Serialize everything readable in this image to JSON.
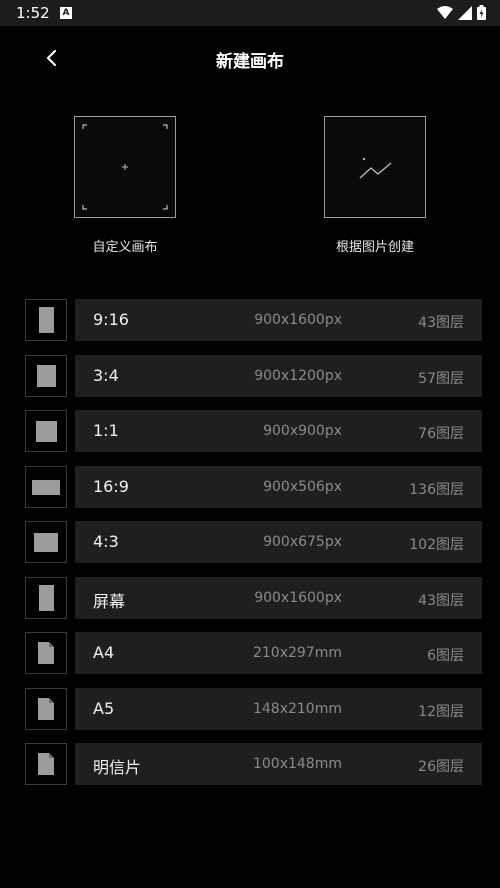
{
  "status": {
    "time": "1:52",
    "notif": "A"
  },
  "header": {
    "title": "新建画布"
  },
  "cards": [
    {
      "label": "自定义画布"
    },
    {
      "label": "根据图片创建"
    }
  ],
  "presets": [
    {
      "name": "9:16",
      "size": "900x1600px",
      "layers": "43图层"
    },
    {
      "name": "3:4",
      "size": "900x1200px",
      "layers": "57图层"
    },
    {
      "name": "1:1",
      "size": "900x900px",
      "layers": "76图层"
    },
    {
      "name": "16:9",
      "size": "900x506px",
      "layers": "136图层"
    },
    {
      "name": "4:3",
      "size": "900x675px",
      "layers": "102图层"
    },
    {
      "name": "屏幕",
      "size": "900x1600px",
      "layers": "43图层"
    },
    {
      "name": "A4",
      "size": "210x297mm",
      "layers": "6图层"
    },
    {
      "name": "A5",
      "size": "148x210mm",
      "layers": "12图层"
    },
    {
      "name": "明信片",
      "size": "100x148mm",
      "layers": "26图层"
    }
  ]
}
